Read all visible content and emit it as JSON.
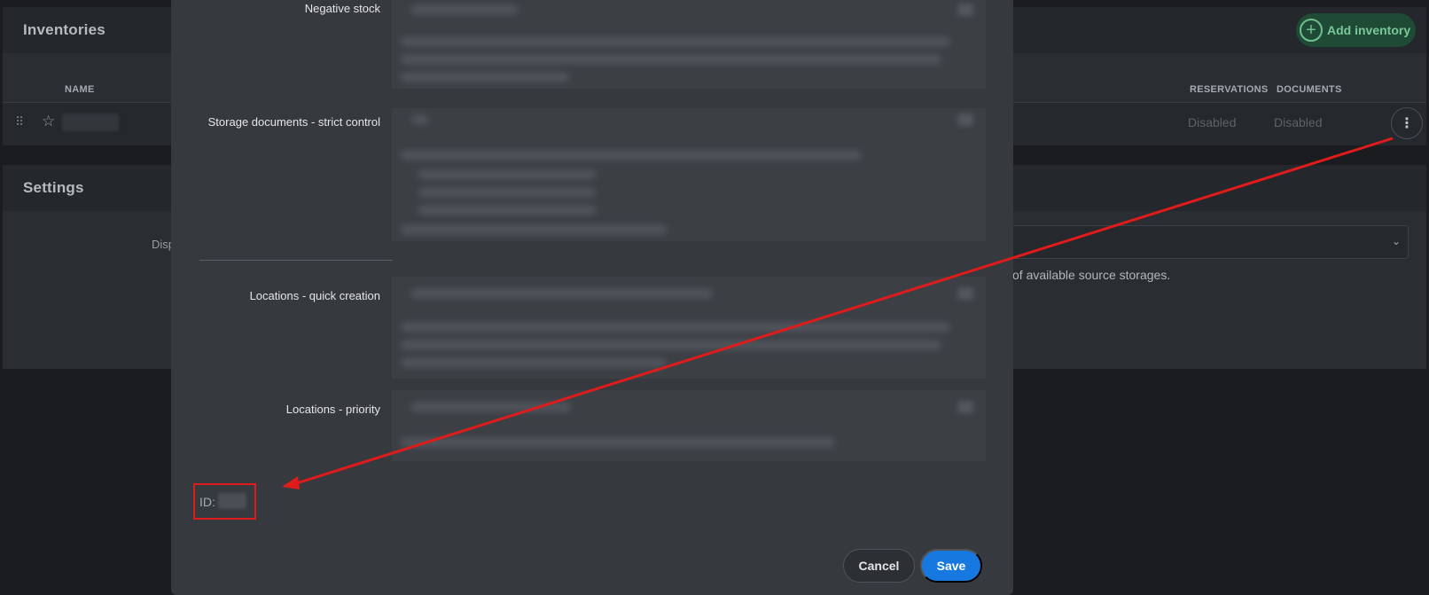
{
  "inventories": {
    "title": "Inventories",
    "add_button_label": "Add inventory",
    "columns": {
      "name": "NAME",
      "reservations": "RESERVATIONS",
      "documents": "DOCUMENTS"
    },
    "row": {
      "reservations": "Disabled",
      "documents": "Disabled"
    }
  },
  "settings": {
    "title": "Settings",
    "field_label_partial": "Disp",
    "hint_partial": "of available source storages."
  },
  "modal": {
    "fields": [
      {
        "label": "Negative stock"
      },
      {
        "label": "Storage documents - strict control"
      },
      {
        "label": "Locations - quick creation"
      },
      {
        "label": "Locations - priority"
      }
    ],
    "id_label": "ID:",
    "cancel_label": "Cancel",
    "save_label": "Save"
  },
  "colors": {
    "annotation_red": "#e01b1b",
    "save_blue": "#1778e0",
    "add_green": "#1f4a35"
  },
  "icons": {
    "drag": "drag-handle-icon",
    "star": "star-icon",
    "plus": "plus-circle-icon",
    "kebab": "more-vertical-icon",
    "chevron": "chevron-down-icon"
  }
}
